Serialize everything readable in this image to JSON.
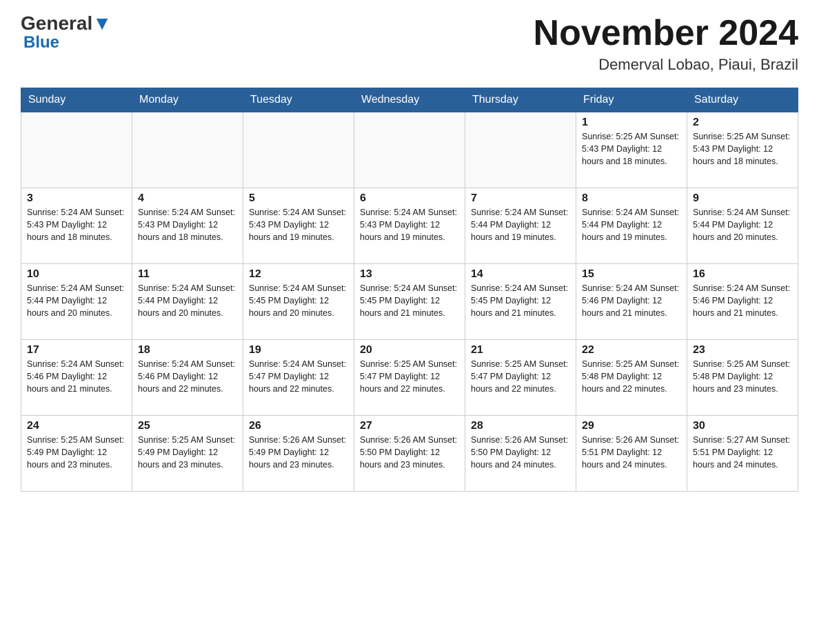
{
  "header": {
    "logo_main": "General",
    "logo_sub": "Blue",
    "month_title": "November 2024",
    "location": "Demerval Lobao, Piaui, Brazil"
  },
  "days_of_week": [
    "Sunday",
    "Monday",
    "Tuesday",
    "Wednesday",
    "Thursday",
    "Friday",
    "Saturday"
  ],
  "weeks": [
    [
      {
        "day": "",
        "info": ""
      },
      {
        "day": "",
        "info": ""
      },
      {
        "day": "",
        "info": ""
      },
      {
        "day": "",
        "info": ""
      },
      {
        "day": "",
        "info": ""
      },
      {
        "day": "1",
        "info": "Sunrise: 5:25 AM\nSunset: 5:43 PM\nDaylight: 12 hours\nand 18 minutes."
      },
      {
        "day": "2",
        "info": "Sunrise: 5:25 AM\nSunset: 5:43 PM\nDaylight: 12 hours\nand 18 minutes."
      }
    ],
    [
      {
        "day": "3",
        "info": "Sunrise: 5:24 AM\nSunset: 5:43 PM\nDaylight: 12 hours\nand 18 minutes."
      },
      {
        "day": "4",
        "info": "Sunrise: 5:24 AM\nSunset: 5:43 PM\nDaylight: 12 hours\nand 18 minutes."
      },
      {
        "day": "5",
        "info": "Sunrise: 5:24 AM\nSunset: 5:43 PM\nDaylight: 12 hours\nand 19 minutes."
      },
      {
        "day": "6",
        "info": "Sunrise: 5:24 AM\nSunset: 5:43 PM\nDaylight: 12 hours\nand 19 minutes."
      },
      {
        "day": "7",
        "info": "Sunrise: 5:24 AM\nSunset: 5:44 PM\nDaylight: 12 hours\nand 19 minutes."
      },
      {
        "day": "8",
        "info": "Sunrise: 5:24 AM\nSunset: 5:44 PM\nDaylight: 12 hours\nand 19 minutes."
      },
      {
        "day": "9",
        "info": "Sunrise: 5:24 AM\nSunset: 5:44 PM\nDaylight: 12 hours\nand 20 minutes."
      }
    ],
    [
      {
        "day": "10",
        "info": "Sunrise: 5:24 AM\nSunset: 5:44 PM\nDaylight: 12 hours\nand 20 minutes."
      },
      {
        "day": "11",
        "info": "Sunrise: 5:24 AM\nSunset: 5:44 PM\nDaylight: 12 hours\nand 20 minutes."
      },
      {
        "day": "12",
        "info": "Sunrise: 5:24 AM\nSunset: 5:45 PM\nDaylight: 12 hours\nand 20 minutes."
      },
      {
        "day": "13",
        "info": "Sunrise: 5:24 AM\nSunset: 5:45 PM\nDaylight: 12 hours\nand 21 minutes."
      },
      {
        "day": "14",
        "info": "Sunrise: 5:24 AM\nSunset: 5:45 PM\nDaylight: 12 hours\nand 21 minutes."
      },
      {
        "day": "15",
        "info": "Sunrise: 5:24 AM\nSunset: 5:46 PM\nDaylight: 12 hours\nand 21 minutes."
      },
      {
        "day": "16",
        "info": "Sunrise: 5:24 AM\nSunset: 5:46 PM\nDaylight: 12 hours\nand 21 minutes."
      }
    ],
    [
      {
        "day": "17",
        "info": "Sunrise: 5:24 AM\nSunset: 5:46 PM\nDaylight: 12 hours\nand 21 minutes."
      },
      {
        "day": "18",
        "info": "Sunrise: 5:24 AM\nSunset: 5:46 PM\nDaylight: 12 hours\nand 22 minutes."
      },
      {
        "day": "19",
        "info": "Sunrise: 5:24 AM\nSunset: 5:47 PM\nDaylight: 12 hours\nand 22 minutes."
      },
      {
        "day": "20",
        "info": "Sunrise: 5:25 AM\nSunset: 5:47 PM\nDaylight: 12 hours\nand 22 minutes."
      },
      {
        "day": "21",
        "info": "Sunrise: 5:25 AM\nSunset: 5:47 PM\nDaylight: 12 hours\nand 22 minutes."
      },
      {
        "day": "22",
        "info": "Sunrise: 5:25 AM\nSunset: 5:48 PM\nDaylight: 12 hours\nand 22 minutes."
      },
      {
        "day": "23",
        "info": "Sunrise: 5:25 AM\nSunset: 5:48 PM\nDaylight: 12 hours\nand 23 minutes."
      }
    ],
    [
      {
        "day": "24",
        "info": "Sunrise: 5:25 AM\nSunset: 5:49 PM\nDaylight: 12 hours\nand 23 minutes."
      },
      {
        "day": "25",
        "info": "Sunrise: 5:25 AM\nSunset: 5:49 PM\nDaylight: 12 hours\nand 23 minutes."
      },
      {
        "day": "26",
        "info": "Sunrise: 5:26 AM\nSunset: 5:49 PM\nDaylight: 12 hours\nand 23 minutes."
      },
      {
        "day": "27",
        "info": "Sunrise: 5:26 AM\nSunset: 5:50 PM\nDaylight: 12 hours\nand 23 minutes."
      },
      {
        "day": "28",
        "info": "Sunrise: 5:26 AM\nSunset: 5:50 PM\nDaylight: 12 hours\nand 24 minutes."
      },
      {
        "day": "29",
        "info": "Sunrise: 5:26 AM\nSunset: 5:51 PM\nDaylight: 12 hours\nand 24 minutes."
      },
      {
        "day": "30",
        "info": "Sunrise: 5:27 AM\nSunset: 5:51 PM\nDaylight: 12 hours\nand 24 minutes."
      }
    ]
  ]
}
